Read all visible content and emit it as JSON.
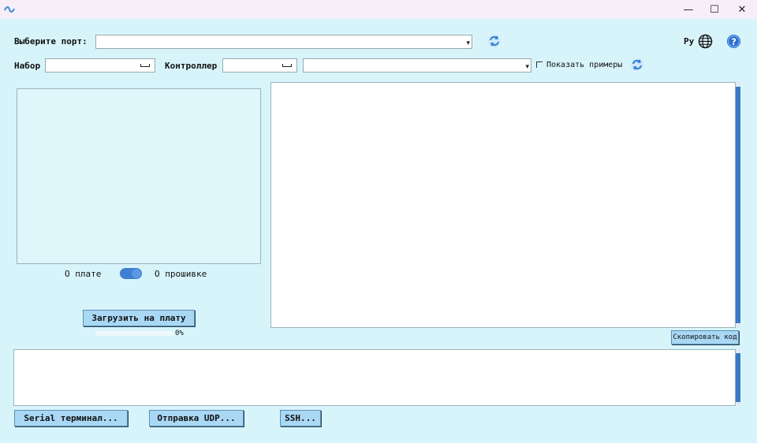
{
  "window": {
    "minimize_glyph": "—",
    "maximize_glyph": "☐",
    "close_glyph": "✕"
  },
  "port": {
    "label": "Выберите порт:",
    "value": ""
  },
  "language": {
    "label": "Ру"
  },
  "kit": {
    "label": "Набор",
    "value": ""
  },
  "controller": {
    "label": "Контроллер",
    "value": "",
    "example_value": ""
  },
  "examples": {
    "label": "Показать примеры",
    "checked": false
  },
  "toggle": {
    "left_label": "О плате",
    "right_label": "О прошивке"
  },
  "upload": {
    "label": "Загрузить на плату",
    "progress_text": "0%",
    "progress": 0
  },
  "code": {
    "copy_label": "Скопировать код"
  },
  "bottom_buttons": {
    "serial": "Serial терминал...",
    "udp": "Отправка UDP...",
    "ssh": "SSH..."
  },
  "colors": {
    "background": "#d8f4fb",
    "button": "#a9d8f5",
    "accent": "#3a78c8",
    "titlebar": "#f7eef8"
  },
  "icons": [
    "app-logo-icon",
    "refresh-icon",
    "globe-icon",
    "help-icon",
    "minimize-icon",
    "maximize-icon",
    "close-icon"
  ]
}
